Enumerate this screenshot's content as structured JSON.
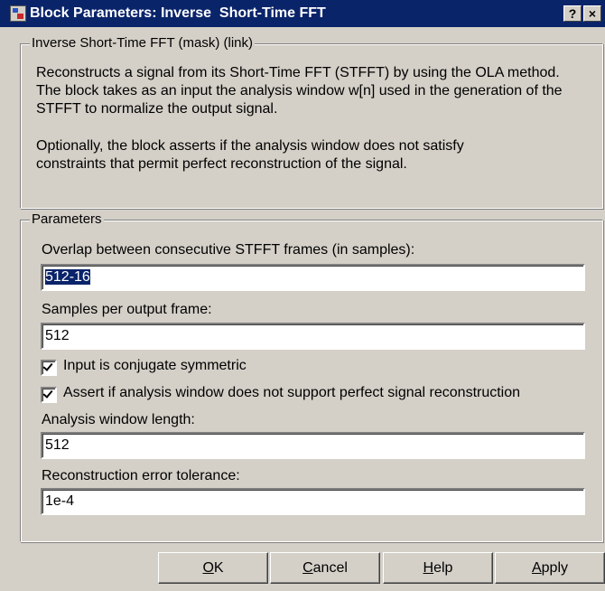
{
  "window": {
    "title": "Block Parameters: Inverse  Short-Time FFT",
    "help_label": "?",
    "close_label": "×"
  },
  "description": {
    "legend": "Inverse Short-Time FFT (mask) (link)",
    "lines": [
      "Reconstructs a signal from its Short-Time FFT (STFFT) by using the OLA method.",
      "The block takes as an input the analysis window w[n] used in the generation of the",
      "STFFT to normalize the output signal.",
      "Optionally, the block asserts if the analysis window does not satisfy",
      "constraints that permit perfect reconstruction of the signal."
    ]
  },
  "parameters": {
    "legend": "Parameters",
    "overlap": {
      "label": "Overlap between consecutive STFFT frames (in samples):",
      "value": "512-16"
    },
    "samples_per_frame": {
      "label": "Samples per output frame:",
      "value": "512"
    },
    "conjugate_symmetric": {
      "label": "Input is conjugate symmetric",
      "checked": true
    },
    "assert_reconstruction": {
      "label": "Assert if analysis window does not support perfect signal reconstruction",
      "checked": true
    },
    "window_length": {
      "label": "Analysis window length:",
      "value": "512"
    },
    "error_tolerance": {
      "label": "Reconstruction error tolerance:",
      "value": "1e-4"
    }
  },
  "buttons": {
    "ok": {
      "accel": "O",
      "rest": "K"
    },
    "cancel": {
      "accel": "C",
      "rest": "ancel"
    },
    "help": {
      "accel": "H",
      "rest": "elp"
    },
    "apply": {
      "accel": "A",
      "rest": "pply"
    }
  }
}
